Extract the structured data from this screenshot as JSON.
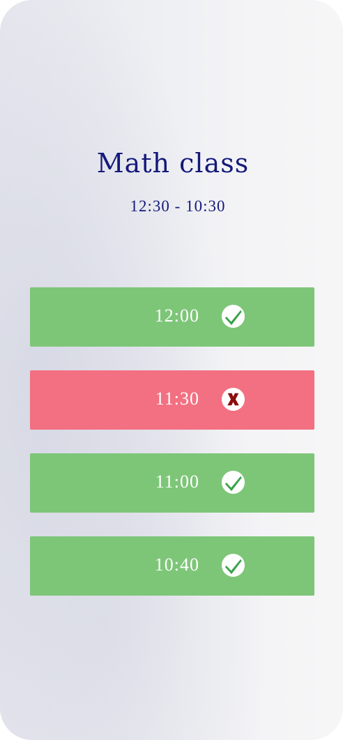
{
  "lesson": {
    "title": "Math class",
    "time_range": "12:30 - 10:30"
  },
  "colors": {
    "title": "#141a7a",
    "ok_row": "#7dc678",
    "bad_row": "#f27081",
    "check": "#3aa24a",
    "cross": "#8b0d0d"
  },
  "entries": [
    {
      "time": "12:00",
      "status": "ok",
      "icon": "check-circle-icon"
    },
    {
      "time": "11:30",
      "status": "bad",
      "icon": "cross-circle-icon"
    },
    {
      "time": "11:00",
      "status": "ok",
      "icon": "check-circle-icon"
    },
    {
      "time": "10:40",
      "status": "ok",
      "icon": "check-circle-icon"
    }
  ]
}
